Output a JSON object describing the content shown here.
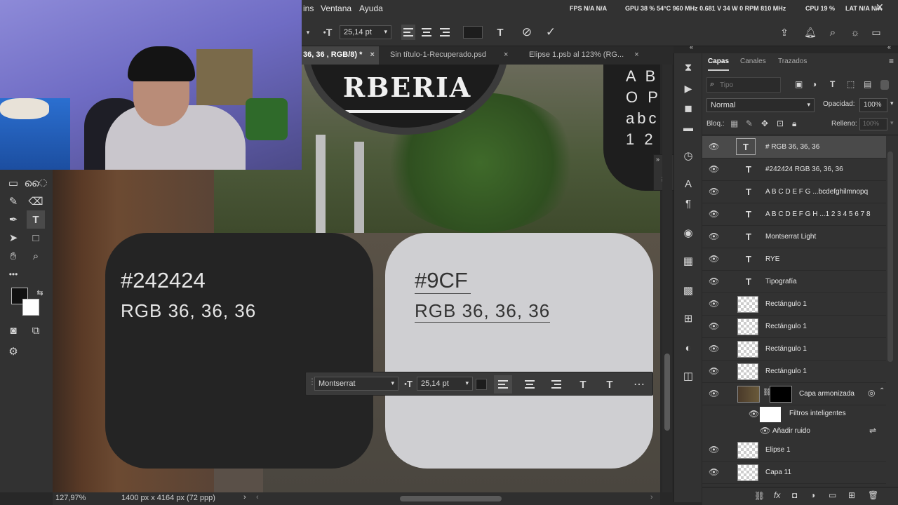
{
  "menu": {
    "items": [
      "ins",
      "Ventana",
      "Ayuda"
    ]
  },
  "perf": {
    "fps": "FPS  N/A  N/A",
    "gpu": "GPU  38 %  54°C  960 MHz  0.681 V  34 W  0 RPM  810 MHz",
    "cpu": "CPU  19 %",
    "lat": "LAT  N/A  N/A"
  },
  "options": {
    "font_size": "25,14 pt"
  },
  "tabs": [
    {
      "label": "36, 36 , RGB/8) *",
      "active": true
    },
    {
      "label": "Sin título-1-Recuperado.psd",
      "active": false
    },
    {
      "label": "Elipse 1.psb al 123% (RG...",
      "active": false
    }
  ],
  "canvas": {
    "sign_text": "RBERIA",
    "type_specimen": [
      "A B",
      "O P",
      "abc",
      "1 2"
    ],
    "card_dark": {
      "hex": "#242424",
      "rgb": "RGB 36, 36, 36",
      "color": "#242424"
    },
    "card_light": {
      "hex": "#9CF",
      "rgb": "RGB 36, 36, 36",
      "color": "#cfcfd2"
    }
  },
  "context_bar": {
    "font": "Montserrat",
    "size": "25,14 pt"
  },
  "status": {
    "zoom": "127,97%",
    "doc": "1400 px x 4164 px (72 ppp)"
  },
  "panel": {
    "tabs": [
      "Capas",
      "Canales",
      "Trazados"
    ],
    "search_placeholder": "Tipo",
    "blend_mode": "Normal",
    "opacity_label": "Opacidad:",
    "opacity": "100%",
    "lock_label": "Bloq.:",
    "fill_label": "Relleno:",
    "fill": "100%",
    "layers": [
      {
        "name": "# RGB 36, 36, 36",
        "kind": "text",
        "selected": true
      },
      {
        "name": "#242424 RGB 36, 36, 36",
        "kind": "text"
      },
      {
        "name": "A B C D E F G ...bcdefghilmnopq",
        "kind": "text"
      },
      {
        "name": "A B C D E F G H ...1 2 3 4 5 6 7 8",
        "kind": "text"
      },
      {
        "name": "Montserrat Light",
        "kind": "text"
      },
      {
        "name": "RYE",
        "kind": "text"
      },
      {
        "name": "Tipografía",
        "kind": "text"
      },
      {
        "name": "Rectángulo 1",
        "kind": "image"
      },
      {
        "name": "Rectángulo 1",
        "kind": "image"
      },
      {
        "name": "Rectángulo 1",
        "kind": "image"
      },
      {
        "name": "Rectángulo 1",
        "kind": "image"
      },
      {
        "name": "Capa armonizada",
        "kind": "smart"
      },
      {
        "name": "Filtros inteligentes",
        "kind": "filters"
      },
      {
        "name": "Añadir ruido",
        "kind": "filter"
      },
      {
        "name": "Elipse 1",
        "kind": "image"
      },
      {
        "name": "Capa 11",
        "kind": "image"
      }
    ]
  }
}
